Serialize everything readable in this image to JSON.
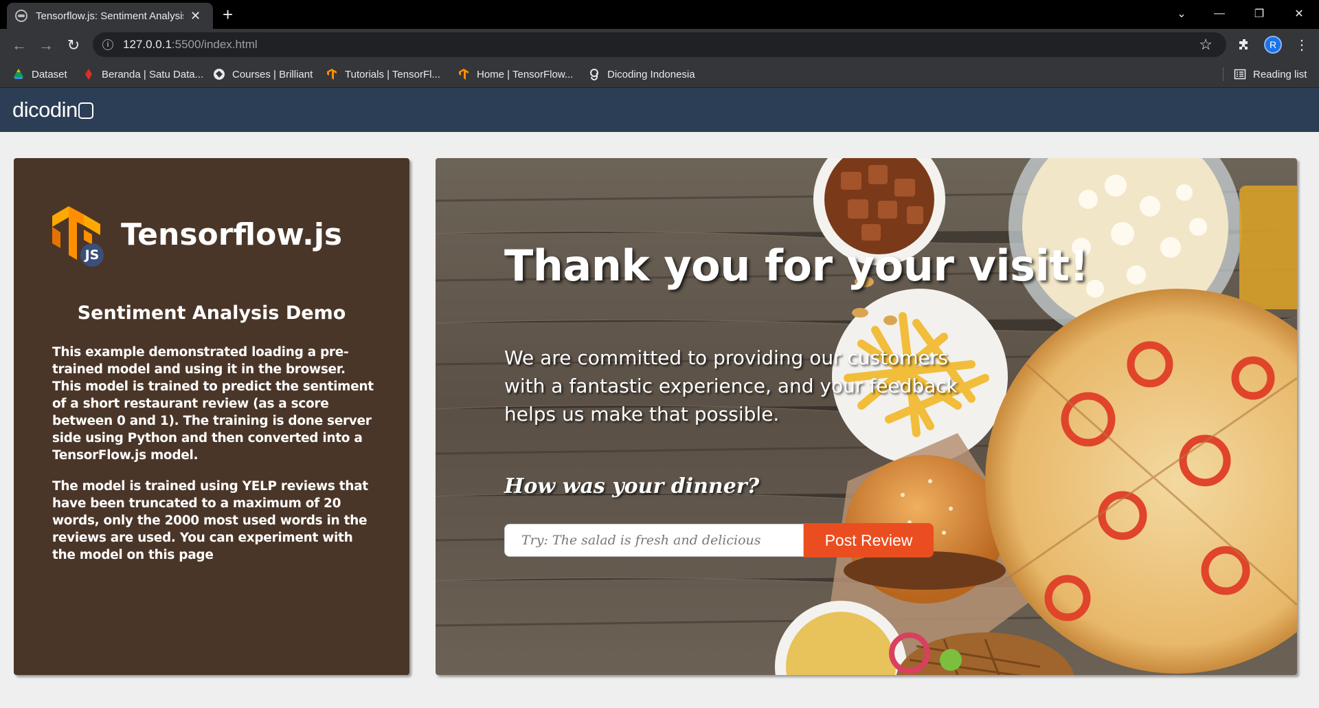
{
  "browser": {
    "tab_title": "Tensorflow.js: Sentiment Analysis",
    "url_host": "127.0.0.1",
    "url_rest": ":5500/index.html",
    "profile_initial": "R",
    "bookmarks": [
      {
        "label": "Dataset",
        "icon": "google-drive-icon"
      },
      {
        "label": "Beranda | Satu Data...",
        "icon": "satu-data-icon"
      },
      {
        "label": "Courses | Brilliant",
        "icon": "brilliant-icon"
      },
      {
        "label": "Tutorials  |  TensorFl...",
        "icon": "tensorflow-icon"
      },
      {
        "label": "Home | TensorFlow...",
        "icon": "tensorflow-icon"
      },
      {
        "label": "Dicoding Indonesia",
        "icon": "dicoding-icon"
      }
    ],
    "reading_list": "Reading list"
  },
  "site": {
    "logo_text": "dicodin",
    "brand": "Tensorflow.js",
    "badge": "JS",
    "demo_title": "Sentiment Analysis Demo",
    "para1": "This example demonstrated loading a pre-trained model and using it in the browser. This model is trained to predict the sentiment of a short restaurant review (as a score between 0 and 1). The training is done server side using Python and then converted into a TensorFlow.js model.",
    "para2": "The model is trained using YELP reviews that have been truncated to a maximum of 20 words, only the 2000 most used words in the reviews are used. You can experiment with the model on this page"
  },
  "hero": {
    "title": "Thank you for your visit!",
    "text": "We are committed to providing our customers with a fantastic experience, and your feedback helps us make that possible.",
    "question": "How was your dinner?",
    "input_placeholder": "Try: The salad is fresh and delicious",
    "button": "Post Review"
  },
  "colors": {
    "header_bg": "#2c3e55",
    "card_bg": "#4a3628",
    "button_bg": "#ea4e20",
    "tf_orange": "#ff8f00"
  }
}
